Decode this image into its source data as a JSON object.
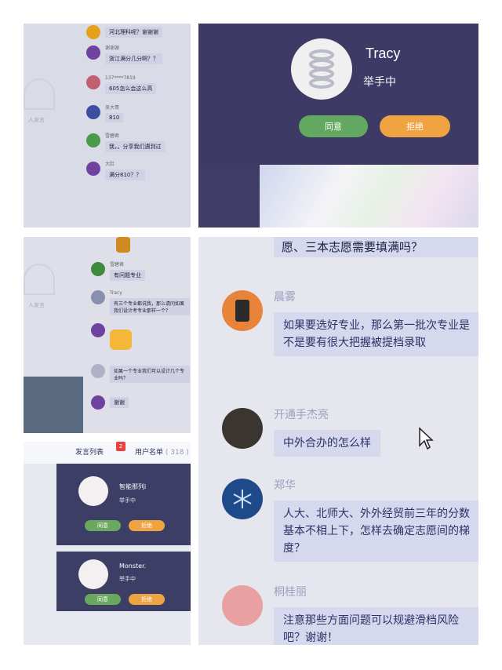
{
  "panel1": {
    "mic_label": "人发言",
    "messages": [
      {
        "name": "",
        "text": "河北理科呢？谢谢谢",
        "color": "#e6a01a"
      },
      {
        "name": "谢谢谢",
        "text": "浙江满分几分啊？？",
        "color": "#7042a0"
      },
      {
        "name": "137****7819",
        "text": "605怎么会这么高",
        "color": "#c06070"
      },
      {
        "name": "吴大哥",
        "text": "810",
        "color": "#3b4ea0"
      },
      {
        "name": "雪碧君",
        "text": "我，。分享我们遇到过",
        "color": "#4a9a4a"
      },
      {
        "name": "大肚",
        "text": "满分810？？",
        "color": "#7042a0"
      }
    ]
  },
  "panel2": {
    "user_name": "Tracy",
    "status": "举手中",
    "agree_label": "同意",
    "reject_label": "拒绝"
  },
  "panel3": {
    "mic_label": "人发言",
    "messages": [
      {
        "name": "雪碧君",
        "text": "有问题专业",
        "color": "#3e8a3e"
      },
      {
        "name": "Tracy",
        "text": "有三个专业都说我，那么请问如果我们设计考专业那样一个？",
        "color": "#8890b0"
      },
      {
        "name": "",
        "text": "",
        "color": "#7042a0"
      },
      {
        "name": "",
        "text": "如果一个专业我们可以设计几个专业吗？",
        "color": "#b0b0c8"
      },
      {
        "name": "",
        "text": "谢谢",
        "color": "#7042a0"
      }
    ]
  },
  "panel4": {
    "top_text": "愿、三本志愿需要填满吗？",
    "messages": [
      {
        "name": "晨雾",
        "text": "如果要选好专业，那么第一批次专业是不是要有很大把握被提档录取",
        "color": "#e8843a"
      },
      {
        "name": "开通手杰亮",
        "text": "中外合办的怎么样",
        "color": "#3a3530"
      },
      {
        "name": "郑华",
        "text": "人大、北师大、外外经贸前三年的分数基本不相上下，怎样去确定志愿间的梯度？",
        "color": "#1f4a8a"
      },
      {
        "name": "桐桂丽",
        "text": "注意那些方面问题可以规避滑档风险吧？谢谢！",
        "color": "#e8a0a0"
      }
    ]
  },
  "panel5": {
    "tab_speech": "发言列表",
    "tab_badge": "2",
    "tab_users": "用户名单",
    "tab_users_count": "( 318 )",
    "users": [
      {
        "name": "智能那列i",
        "status": "举手中",
        "agree": "同意",
        "reject": "拒绝"
      },
      {
        "name": "Monster.",
        "status": "举手中",
        "agree": "同意",
        "reject": "拒绝"
      }
    ]
  }
}
